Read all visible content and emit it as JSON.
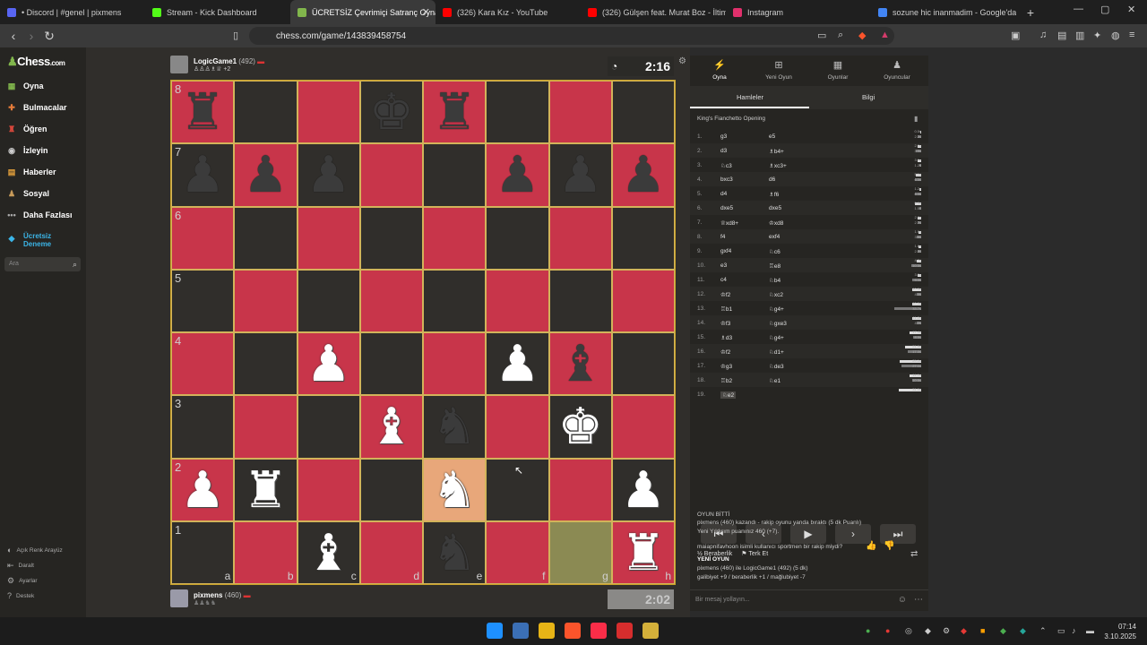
{
  "browser": {
    "tabs": [
      {
        "title": "• Discord | #genel | pixmens",
        "color": "#5865f2",
        "active": false
      },
      {
        "title": "Stream - Kick Dashboard",
        "color": "#53fc18",
        "active": false
      },
      {
        "title": "ÜCRETSİZ Çevrimiçi Satranç Oyna",
        "color": "#81b64c",
        "active": true
      },
      {
        "title": "(326) Kara Kız - YouTube",
        "color": "#ff0000",
        "active": false
      },
      {
        "title": "(326) Gülşen feat. Murat Boz - İltimas",
        "color": "#ff0000",
        "active": false
      },
      {
        "title": "Instagram",
        "color": "#e1306c",
        "active": false
      },
      {
        "title": "sozune hic inanmadim - Google'da Ara",
        "color": "#4285f4",
        "active": false
      }
    ],
    "url": "chess.com/game/143839458754"
  },
  "sidebar": {
    "logo_pre": "Chess",
    "logo_post": ".com",
    "items": [
      {
        "label": "Oyna",
        "icon": "play-board-icon",
        "color": "#81b64c"
      },
      {
        "label": "Bulmacalar",
        "icon": "puzzle-icon",
        "color": "#e67c3a"
      },
      {
        "label": "Öğren",
        "icon": "learn-icon",
        "color": "#d6473b"
      },
      {
        "label": "İzleyin",
        "icon": "watch-icon",
        "color": "#cccccc"
      },
      {
        "label": "Haberler",
        "icon": "news-icon",
        "color": "#e6a23c"
      },
      {
        "label": "Sosyal",
        "icon": "social-icon",
        "color": "#c89b5a"
      },
      {
        "label": "Daha Fazlası",
        "icon": "more-icon",
        "color": "#aaaaaa"
      }
    ],
    "premium": "Ücretsiz Deneme",
    "search_placeholder": "Ara",
    "footer": [
      "Açık Renk Arayüz",
      "Daralt",
      "Ayarlar",
      "Destek"
    ]
  },
  "game": {
    "top_player": {
      "name": "LogicGame1",
      "rating": "(492)",
      "extra": "+2"
    },
    "bottom_player": {
      "name": "pixmens",
      "rating": "(460)"
    },
    "top_clock": "2:16",
    "bottom_clock": "2:02",
    "ranks": [
      "8",
      "7",
      "6",
      "5",
      "4",
      "3",
      "2",
      "1"
    ],
    "files": [
      "a",
      "b",
      "c",
      "d",
      "e",
      "f",
      "g",
      "h"
    ],
    "board": [
      [
        "bR",
        "",
        "",
        "bK",
        "bR",
        "",
        "",
        ""
      ],
      [
        "bP",
        "bP",
        "bP",
        "",
        "",
        "bP",
        "bP",
        "bP"
      ],
      [
        "",
        "",
        "",
        "",
        "",
        "",
        "",
        ""
      ],
      [
        "",
        "",
        "",
        "",
        "",
        "",
        "",
        ""
      ],
      [
        "",
        "",
        "wP",
        "",
        "",
        "wP",
        "bB",
        ""
      ],
      [
        "",
        "",
        "",
        "wB",
        "bN",
        "",
        "wK",
        ""
      ],
      [
        "wP",
        "wR",
        "",
        "",
        "wN",
        "",
        "",
        "wP"
      ],
      [
        "",
        "",
        "wB",
        "",
        "bN",
        "",
        "",
        "wR"
      ]
    ],
    "highlight": {
      "last_from": "g1",
      "last_to": "e2"
    }
  },
  "panel": {
    "tabs": [
      {
        "label": "Oyna",
        "icon": "bolt-icon"
      },
      {
        "label": "Yeni Oyun",
        "icon": "plus-icon"
      },
      {
        "label": "Oyunlar",
        "icon": "grid-icon"
      },
      {
        "label": "Oyuncular",
        "icon": "players-icon"
      }
    ],
    "subtabs": [
      "Hamleler",
      "Bilgi"
    ],
    "opening": "King's Fianchetto Opening",
    "moves": [
      {
        "n": "1.",
        "w": "g3",
        "b": "e5",
        "wt": "0.5s",
        "bt": "2.2s"
      },
      {
        "n": "2.",
        "w": "d3",
        "b": "♗b4+",
        "wt": "2.2s",
        "bt": "3.9s"
      },
      {
        "n": "3.",
        "w": "♘c3",
        "b": "♗xc3+",
        "wt": "3.0s",
        "bt": "1.2s"
      },
      {
        "n": "4.",
        "w": "bxc3",
        "b": "d6",
        "wt": "5.1s",
        "bt": "6.3s"
      },
      {
        "n": "5.",
        "w": "d4",
        "b": "♗f6",
        "wt": "1.2s",
        "bt": "6.3s"
      },
      {
        "n": "6.",
        "w": "dxe5",
        "b": "dxe5",
        "wt": "6.9s",
        "bt": "1.5s"
      },
      {
        "n": "7.",
        "w": "♕xd8+",
        "b": "♔xd8",
        "wt": "2.8s",
        "bt": "2.7s"
      },
      {
        "n": "8.",
        "w": "f4",
        "b": "exf4",
        "wt": "1.9s",
        "bt": "3.8s"
      },
      {
        "n": "9.",
        "w": "gxf4",
        "b": "♘c6",
        "wt": "1.6s",
        "bt": "2.8s"
      },
      {
        "n": "10.",
        "w": "e3",
        "b": "♖e8",
        "wt": "4.7s",
        "bt": "10.5s"
      },
      {
        "n": "11.",
        "w": "c4",
        "b": "♘b4",
        "wt": "3.3s",
        "bt": "9.4s"
      },
      {
        "n": "12.",
        "w": "♔f2",
        "b": "♘xc2",
        "wt": "10.0s",
        "bt": "4.4s"
      },
      {
        "n": "13.",
        "w": "♖b1",
        "b": "♘g4+",
        "wt": "10.0s",
        "bt": "33.7s"
      },
      {
        "n": "14.",
        "w": "♔f3",
        "b": "♘gxe3",
        "wt": "11.2s",
        "bt": "4.2s"
      },
      {
        "n": "15.",
        "w": "♗d3",
        "b": "♘g4+",
        "wt": "17.4s",
        "bt": "8.8s"
      },
      {
        "n": "16.",
        "w": "♔f2",
        "b": "♘d1+",
        "wt": "21.9s",
        "bt": "17.0s"
      },
      {
        "n": "17.",
        "w": "♔g3",
        "b": "♘de3",
        "wt": "29.1s",
        "bt": "27.1s"
      },
      {
        "n": "18.",
        "w": "♖b2",
        "b": "♘e1",
        "wt": "14.1s",
        "bt": "10.5s"
      },
      {
        "n": "19.",
        "w": "♘e2",
        "b": "",
        "wt": "31.0s",
        "bt": ""
      }
    ],
    "move_fracs": [
      {
        "w": 0.04,
        "b": 0.12
      },
      {
        "w": 0.12,
        "b": 0.2
      },
      {
        "w": 0.15,
        "b": 0.07
      },
      {
        "w": 0.2,
        "b": 0.25
      },
      {
        "w": 0.07,
        "b": 0.25
      },
      {
        "w": 0.25,
        "b": 0.08
      },
      {
        "w": 0.12,
        "b": 0.12
      },
      {
        "w": 0.1,
        "b": 0.18
      },
      {
        "w": 0.09,
        "b": 0.14
      },
      {
        "w": 0.18,
        "b": 0.38
      },
      {
        "w": 0.14,
        "b": 0.32
      },
      {
        "w": 0.32,
        "b": 0.17
      },
      {
        "w": 0.32,
        "b": 1.0
      },
      {
        "w": 0.35,
        "b": 0.16
      },
      {
        "w": 0.45,
        "b": 0.3
      },
      {
        "w": 0.6,
        "b": 0.5
      },
      {
        "w": 0.8,
        "b": 0.75
      },
      {
        "w": 0.42,
        "b": 0.32
      },
      {
        "w": 0.85,
        "b": 0
      }
    ],
    "controls": [
      "⏮",
      "‹",
      "▶",
      "›",
      "⏭"
    ],
    "draw_label": "Beraberlik",
    "resign_label": "Terk Et",
    "chat": {
      "line1": "OYUN BİTTİ",
      "line2": "pixmens (460) kazandı - rakip oyunu yanda bıraktı (5 dk Puanlı)",
      "line3": "Yeni Yıldırım puanınız 460 (+7).",
      "line4": "maiapnifavhoon isimli kullanıcı sportmen bir rakip miydi?",
      "line5": "YENİ OYUN",
      "line6": "pixmens (460) ile LogicGame1 (492) (5 dk)",
      "line7": "galibiyet +9 / beraberlik +1 / mağlubiyet -7"
    },
    "message_placeholder": "Bir mesaj yollayın..."
  },
  "taskbar": {
    "time": "07:14",
    "date": "3.10.2025"
  }
}
